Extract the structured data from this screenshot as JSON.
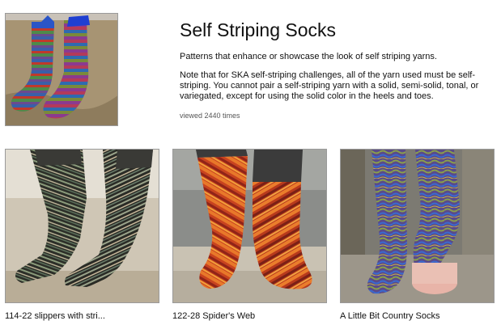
{
  "collection": {
    "title": "Self Striping Socks",
    "description": "Patterns that enhance or showcase the look of self striping yarns.",
    "note": "Note that for SKA self-striping challenges, all of the yarn used must be self-striping. You cannot pair a self-striping yarn with a solid, semi-solid, tonal, or variegated, except for using the solid color in the heels and toes.",
    "views": "viewed 2440 times",
    "thumbnail": "striped-socks-photo"
  },
  "patterns": [
    {
      "title": "114-22 slippers with stri...",
      "thumbnail": "dark-striped-slippers-photo"
    },
    {
      "title": "122-28 Spider's Web",
      "thumbnail": "orange-red-socks-photo"
    },
    {
      "title": "A Little Bit Country Socks",
      "thumbnail": "purple-wavy-socks-photo"
    }
  ]
}
